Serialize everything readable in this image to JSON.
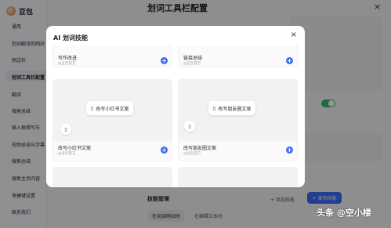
{
  "app": {
    "name": "豆包"
  },
  "sidebar": {
    "items": [
      {
        "label": "通用"
      },
      {
        "label": "划词翻译的网站"
      },
      {
        "label": "侧边栏"
      },
      {
        "label": "划词工具栏配置",
        "active": true
      },
      {
        "label": "翻译"
      },
      {
        "label": "搜索总结"
      },
      {
        "label": "输入框撰写与"
      },
      {
        "label": "视频总结与字幕"
      },
      {
        "label": "搜索总结"
      },
      {
        "label": "搜索主页内容"
      },
      {
        "label": "快捷键设置"
      },
      {
        "label": "联系我们"
      }
    ]
  },
  "page": {
    "title": "划词工具栏配置",
    "close": "×"
  },
  "skills": {
    "title": "技能管理",
    "add_link": "+ 添加技能",
    "publish": "+ 发布技能",
    "tabs": [
      "在阅读网站时",
      "在编辑文本时"
    ]
  },
  "modal": {
    "title": "AI 划词技能",
    "close": "×",
    "tiles": [
      {
        "name": "写作改进",
        "by": "@豆包官方",
        "chip": ""
      },
      {
        "name": "链接总结",
        "by": "@豆包官方",
        "chip": ""
      },
      {
        "name": "改写小红书文案",
        "by": "@豆包官方",
        "chip": "改写小红书文案"
      },
      {
        "name": "改写朋友圈文案",
        "by": "@豆包官方",
        "chip": "改写朋友圈文案"
      }
    ]
  },
  "watermark": "头条 @空小楼",
  "colors": {
    "accent": "#3b6cf6",
    "toggle": "#34b56b"
  }
}
